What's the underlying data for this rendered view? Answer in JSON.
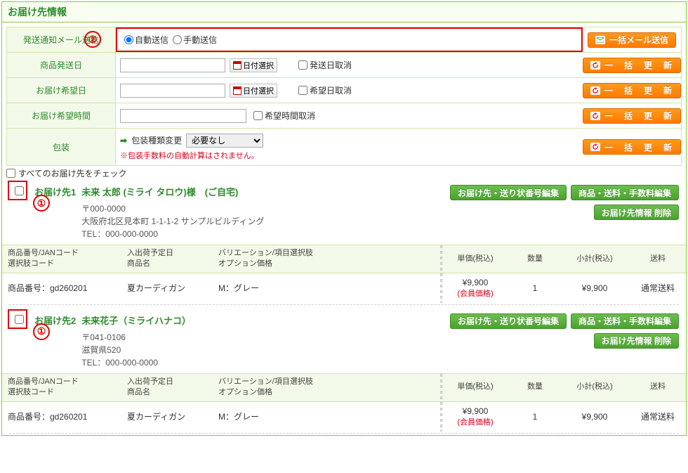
{
  "title": "お届け先情報",
  "settings": {
    "mail": {
      "label": "発送通知メール送信",
      "auto": "自動送信",
      "manual": "手動送信",
      "button": "一括メール送信"
    },
    "shipDate": {
      "label": "商品発送日",
      "datepick": "日付選択",
      "cancel": "発送日取消",
      "button": "一　括　更　新"
    },
    "wishDate": {
      "label": "お届け希望日",
      "datepick": "日付選択",
      "cancel": "希望日取消",
      "button": "一　括　更　新"
    },
    "wishTime": {
      "label": "お届け希望時間",
      "cancel": "希望時間取消",
      "button": "一　括　更　新"
    },
    "packaging": {
      "label": "包装",
      "changeLabel": "包装種類変更",
      "option": "必要なし",
      "note": "※包装手数料の自動計算はされません。",
      "button": "一　括　更　新"
    }
  },
  "checkAll": "すべてのお届け先をチェック",
  "buttons": {
    "editDest": "お届け先・送り状番号編集",
    "editFee": "商品・送料・手数料編集",
    "deleteDest": "お届け先情報 削除"
  },
  "columns": {
    "code": "商品番号/JANコード\n選択肢コード",
    "schedule": "入出荷予定日\n商品名",
    "variation": "バリエーション/項目選択肢\nオプション価格",
    "unitPrice": "単価(税込)",
    "qty": "数量",
    "subtotal": "小計(税込)",
    "shipping": "送料"
  },
  "destinations": [
    {
      "no": "お届け先1",
      "name": "未来 太郎 (ミライ タロウ)様　(ご自宅)",
      "zip": "〒000-0000",
      "addr": "大阪府北区見本町 1-1-1-2 サンプルビルディング",
      "tel": "TEL：000-000-0000",
      "items": [
        {
          "code": "商品番号：gd260201",
          "name": "夏カーディガン",
          "variation": "M：グレー",
          "price": "¥9,900",
          "memberPrice": "(会員価格)",
          "qty": "1",
          "subtotal": "¥9,900",
          "shipping": "通常送料"
        }
      ]
    },
    {
      "no": "お届け先2",
      "name": "未来花子（ミライハナコ）",
      "zip": "〒041-0106",
      "addr": "滋賀県520",
      "tel": "TEL：000-000-0000",
      "items": [
        {
          "code": "商品番号：gd260201",
          "name": "夏カーディガン",
          "variation": "M：グレー",
          "price": "¥9,900",
          "memberPrice": "(会員価格)",
          "qty": "1",
          "subtotal": "¥9,900",
          "shipping": "通常送料"
        }
      ]
    }
  ],
  "ann": {
    "one": "①",
    "two": "②"
  }
}
